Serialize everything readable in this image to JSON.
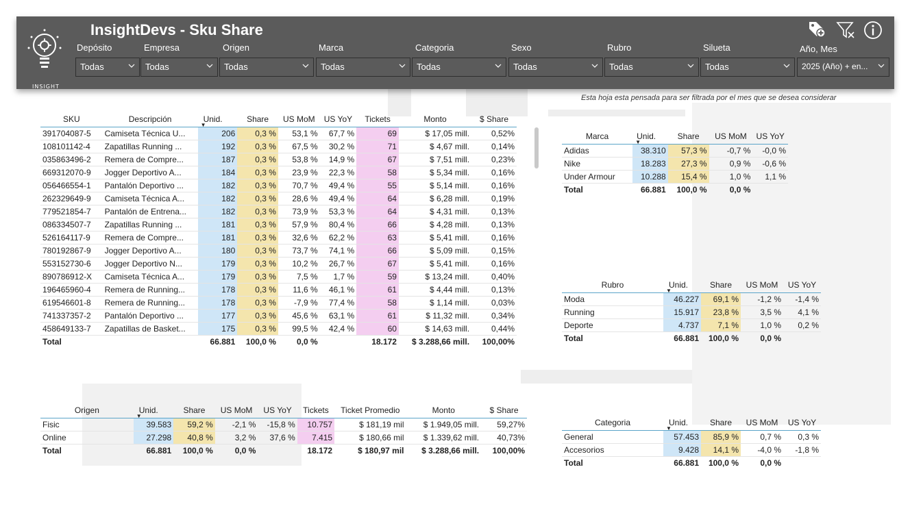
{
  "app": {
    "title": "InsightDevs - Sku Share",
    "logo_text": "INSIGHT",
    "note": "Esta hoja esta pensada para ser filtrada por el mes que se desea considerar"
  },
  "filters": [
    {
      "label": "Depósito",
      "value": "Todas"
    },
    {
      "label": "Empresa",
      "value": "Todas"
    },
    {
      "label": "Origen",
      "value": "Todas"
    },
    {
      "label": "Marca",
      "value": "Todas"
    },
    {
      "label": "Categoria",
      "value": "Todas"
    },
    {
      "label": "Sexo",
      "value": "Todas"
    },
    {
      "label": "Rubro",
      "value": "Todas"
    },
    {
      "label": "Silueta",
      "value": "Todas"
    },
    {
      "label": "Año, Mes",
      "value": "2025 (Año) + en..."
    }
  ],
  "header_icons": [
    "tag-plus-icon",
    "filter-clear-icon",
    "info-icon"
  ],
  "colors": {
    "header_bg": "#5b5b5b",
    "units_bg": "#cfe6f7",
    "share_bg": "#f4e5ad",
    "tickets_bg": "#f4cef0",
    "rule": "#5aa4c8"
  },
  "sku_table": {
    "columns": [
      "SKU",
      "Descripción",
      "Unid.",
      "Share",
      "US MoM",
      "US YoY",
      "Tickets",
      "Monto",
      "$ Share"
    ],
    "rows": [
      [
        "391704087-5",
        "Camiseta Técnica U...",
        "206",
        "0,3 %",
        "53,1 %",
        "67,7 %",
        "69",
        "$ 17,05 mill.",
        "0,52%"
      ],
      [
        "108101142-4",
        "Zapatillas Running ...",
        "192",
        "0,3 %",
        "67,5 %",
        "30,2 %",
        "71",
        "$ 4,67 mill.",
        "0,14%"
      ],
      [
        "035863496-2",
        "Remera de Compre...",
        "187",
        "0,3 %",
        "53,8 %",
        "14,9 %",
        "67",
        "$ 7,51 mill.",
        "0,23%"
      ],
      [
        "669312070-9",
        "Jogger Deportivo A...",
        "184",
        "0,3 %",
        "23,9 %",
        "22,3 %",
        "58",
        "$ 5,34 mill.",
        "0,16%"
      ],
      [
        "056466554-1",
        "Pantalón Deportivo ...",
        "182",
        "0,3 %",
        "70,7 %",
        "49,4 %",
        "55",
        "$ 5,14 mill.",
        "0,16%"
      ],
      [
        "262329649-9",
        "Camiseta Técnica A...",
        "182",
        "0,3 %",
        "28,6 %",
        "49,4 %",
        "64",
        "$ 6,28 mill.",
        "0,19%"
      ],
      [
        "779521854-7",
        "Pantalón de Entrena...",
        "182",
        "0,3 %",
        "73,9 %",
        "53,3 %",
        "64",
        "$ 4,31 mill.",
        "0,13%"
      ],
      [
        "086334507-7",
        "Zapatillas Running ...",
        "181",
        "0,3 %",
        "57,9 %",
        "80,4 %",
        "66",
        "$ 4,28 mill.",
        "0,13%"
      ],
      [
        "526164117-9",
        "Remera de Compre...",
        "181",
        "0,3 %",
        "32,6 %",
        "62,2 %",
        "63",
        "$ 5,41 mill.",
        "0,16%"
      ],
      [
        "780192867-9",
        "Jogger Deportivo A...",
        "180",
        "0,3 %",
        "73,7 %",
        "74,1 %",
        "66",
        "$ 5,09 mill.",
        "0,15%"
      ],
      [
        "553152730-6",
        "Jogger Deportivo N...",
        "179",
        "0,3 %",
        "10,2 %",
        "26,7 %",
        "67",
        "$ 5,41 mill.",
        "0,16%"
      ],
      [
        "890786912-X",
        "Camiseta Técnica A...",
        "179",
        "0,3 %",
        "7,5 %",
        "1,7 %",
        "59",
        "$ 13,24 mill.",
        "0,40%"
      ],
      [
        "196465960-4",
        "Remera de Running...",
        "178",
        "0,3 %",
        "11,6 %",
        "46,1 %",
        "61",
        "$ 4,44 mill.",
        "0,13%"
      ],
      [
        "619546601-8",
        "Remera de Running...",
        "178",
        "0,3 %",
        "-7,9 %",
        "77,4 %",
        "58",
        "$ 1,14 mill.",
        "0,03%"
      ],
      [
        "741337357-2",
        "Pantalón Deportivo ...",
        "177",
        "0,3 %",
        "45,6 %",
        "63,1 %",
        "61",
        "$ 11,32 mill.",
        "0,34%"
      ],
      [
        "458649133-7",
        "Zapatillas de Basket...",
        "175",
        "0,3 %",
        "99,5 %",
        "42,4 %",
        "60",
        "$ 14,63 mill.",
        "0,44%"
      ]
    ],
    "total": [
      "Total",
      "",
      "66.881",
      "100,0 %",
      "0,0 %",
      "",
      "18.172",
      "$ 3.288,66 mill.",
      "100,00%"
    ]
  },
  "origen_table": {
    "columns": [
      "Origen",
      "Unid.",
      "Share",
      "US MoM",
      "US YoY",
      "Tickets",
      "Ticket Promedio",
      "Monto",
      "$ Share"
    ],
    "rows": [
      [
        "Fisic",
        "39.583",
        "59,2 %",
        "-2,1 %",
        "-15,8 %",
        "10.757",
        "$ 181,19 mil",
        "$ 1.949,05 mill.",
        "59,27%"
      ],
      [
        "Online",
        "27.298",
        "40,8 %",
        "3,2 %",
        "37,6 %",
        "7.415",
        "$ 180,66 mil",
        "$ 1.339,62 mill.",
        "40,73%"
      ]
    ],
    "total": [
      "Total",
      "66.881",
      "100,0 %",
      "0,0 %",
      "",
      "18.172",
      "$ 180,97 mil",
      "$ 3.288,66 mill.",
      "100,00%"
    ]
  },
  "marca_table": {
    "columns": [
      "Marca",
      "Unid.",
      "Share",
      "US MoM",
      "US YoY"
    ],
    "rows": [
      [
        "Adidas",
        "38.310",
        "57,3 %",
        "-0,7 %",
        "-0,0 %"
      ],
      [
        "Nike",
        "18.283",
        "27,3 %",
        "0,9 %",
        "-0,6 %"
      ],
      [
        "Under Armour",
        "10.288",
        "15,4 %",
        "1,0 %",
        "1,1 %"
      ]
    ],
    "total": [
      "Total",
      "66.881",
      "100,0 %",
      "0,0 %",
      ""
    ]
  },
  "rubro_table": {
    "columns": [
      "Rubro",
      "Unid.",
      "Share",
      "US MoM",
      "US YoY"
    ],
    "rows": [
      [
        "Moda",
        "46.227",
        "69,1 %",
        "-1,2 %",
        "-1,4 %"
      ],
      [
        "Running",
        "15.917",
        "23,8 %",
        "3,5 %",
        "4,1 %"
      ],
      [
        "Deporte",
        "4.737",
        "7,1 %",
        "1,0 %",
        "0,2 %"
      ]
    ],
    "total": [
      "Total",
      "66.881",
      "100,0 %",
      "0,0 %",
      ""
    ]
  },
  "categoria_table": {
    "columns": [
      "Categoria",
      "Unid.",
      "Share",
      "US MoM",
      "US YoY"
    ],
    "rows": [
      [
        "General",
        "57.453",
        "85,9 %",
        "0,7 %",
        "0,3 %"
      ],
      [
        "Accesorios",
        "9.428",
        "14,1 %",
        "-4,0 %",
        "-1,8 %"
      ]
    ],
    "total": [
      "Total",
      "66.881",
      "100,0 %",
      "0,0 %",
      ""
    ]
  }
}
